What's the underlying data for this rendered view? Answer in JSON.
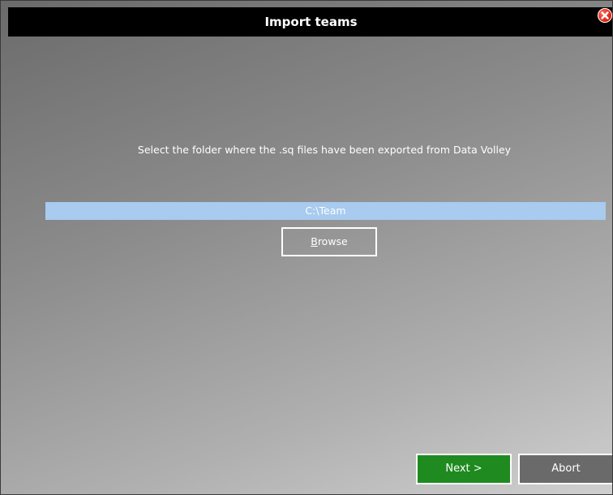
{
  "window": {
    "title": "Import teams"
  },
  "dialog": {
    "instruction": "Select the folder where the .sq files have been exported from Data Volley",
    "folder_path": "C:\\Team",
    "browse_label_first": "B",
    "browse_label_rest": "rowse"
  },
  "footer": {
    "next_label": "Next >",
    "abort_label": "Abort"
  },
  "icons": {
    "close": "close-icon"
  },
  "colors": {
    "titlebar": "#000000",
    "path_field": "#a8cbef",
    "next_button": "#1f8a1f",
    "abort_button": "#6a6a6a",
    "close_button": "#e0281a"
  }
}
